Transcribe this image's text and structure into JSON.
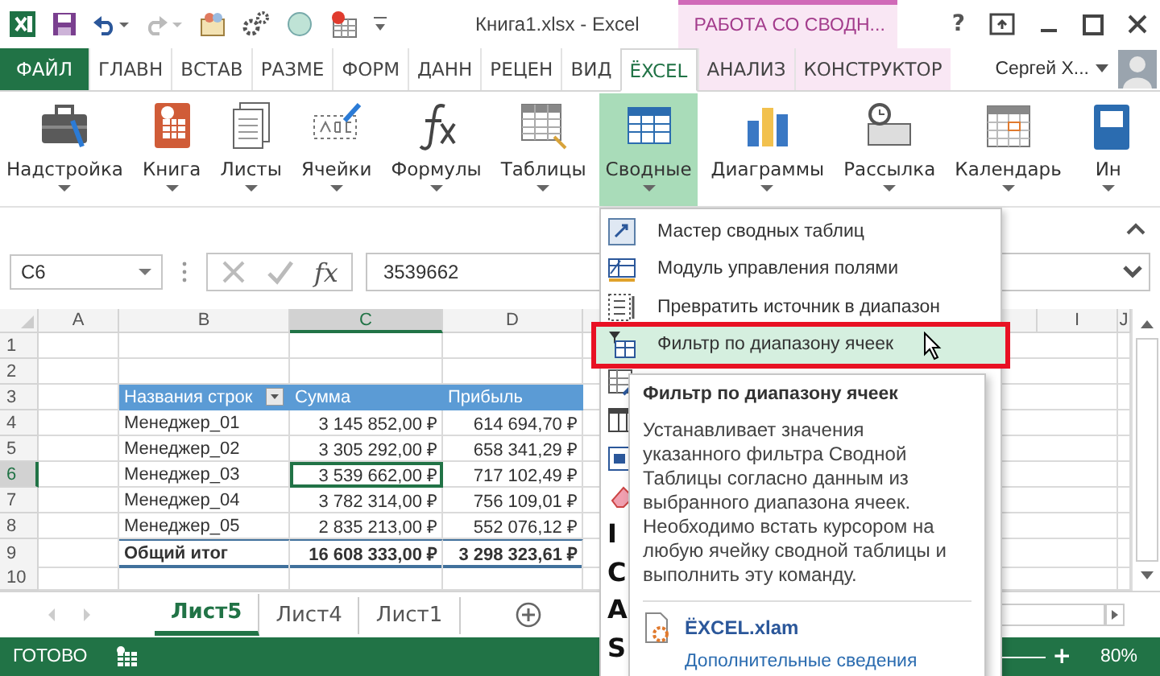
{
  "title_bar": {
    "title": "Книга1.xlsx - Excel",
    "context_tab": "РАБОТА СО СВОДН...",
    "help": "?"
  },
  "ribbon_tabs": [
    {
      "label": "ФАЙЛ",
      "kind": "file",
      "selected": false
    },
    {
      "label": "ГЛАВН",
      "kind": "tab",
      "selected": false
    },
    {
      "label": "ВСТАВ",
      "kind": "tab",
      "selected": false
    },
    {
      "label": "РАЗМЕ",
      "kind": "tab",
      "selected": false
    },
    {
      "label": "ФОРМ",
      "kind": "tab",
      "selected": false
    },
    {
      "label": "ДАНН",
      "kind": "tab",
      "selected": false
    },
    {
      "label": "РЕЦЕН",
      "kind": "tab",
      "selected": false
    },
    {
      "label": "ВИД",
      "kind": "tab",
      "selected": false
    },
    {
      "label": "ЁXCEL",
      "kind": "tab",
      "selected": true
    },
    {
      "label": "АНАЛИЗ",
      "kind": "context",
      "selected": false
    },
    {
      "label": "КОНСТРУКТОР",
      "kind": "context",
      "selected": false
    }
  ],
  "user": {
    "name": "Сергей Х..."
  },
  "ribbon_buttons": [
    {
      "label": "Надстройка",
      "kind": "toolbox",
      "selected": false
    },
    {
      "label": "Книга",
      "kind": "book",
      "selected": false
    },
    {
      "label": "Листы",
      "kind": "pages",
      "selected": false
    },
    {
      "label": "Ячейки",
      "kind": "textbox",
      "selected": false
    },
    {
      "label": "Формулы",
      "kind": "formula",
      "selected": false
    },
    {
      "label": "Таблицы",
      "kind": "table",
      "selected": false
    },
    {
      "label": "Сводные",
      "kind": "pivot",
      "selected": true
    },
    {
      "label": "Диаграммы",
      "kind": "chart",
      "selected": false
    },
    {
      "label": "Рассылка",
      "kind": "mail",
      "selected": false
    },
    {
      "label": "Календарь",
      "kind": "calendar",
      "selected": false
    },
    {
      "label": "Ин",
      "kind": "info",
      "selected": false
    }
  ],
  "formula_bar": {
    "name_box": "C6",
    "function_label": "fx",
    "value": "3539662"
  },
  "sheet": {
    "columns": [
      {
        "label": "A",
        "selected": false
      },
      {
        "label": "B",
        "selected": false
      },
      {
        "label": "C",
        "selected": true
      },
      {
        "label": "D",
        "selected": false
      },
      {
        "label": "I",
        "selected": false
      },
      {
        "label": "J",
        "selected": false
      }
    ],
    "rows": [
      {
        "number": "1",
        "selected": false,
        "kind": "empty"
      },
      {
        "number": "2",
        "selected": false,
        "kind": "empty"
      },
      {
        "number": "3",
        "selected": false,
        "kind": "header",
        "cells": [
          {
            "text": "Названия строк",
            "selected": false
          },
          {
            "text": "Сумма",
            "selected": false
          },
          {
            "text": "Прибыль",
            "selected": false
          }
        ]
      },
      {
        "number": "4",
        "selected": false,
        "kind": "data",
        "cells": [
          {
            "text": "Менеджер_01",
            "selected": false
          },
          {
            "text": "3 145 852,00 ₽",
            "selected": false
          },
          {
            "text": "614 694,70 ₽",
            "selected": false
          }
        ]
      },
      {
        "number": "5",
        "selected": false,
        "kind": "data",
        "cells": [
          {
            "text": "Менеджер_02",
            "selected": false
          },
          {
            "text": "3 305 292,00 ₽",
            "selected": false
          },
          {
            "text": "658 341,29 ₽",
            "selected": false
          }
        ]
      },
      {
        "number": "6",
        "selected": true,
        "kind": "data",
        "cells": [
          {
            "text": "Менеджер_03",
            "selected": false
          },
          {
            "text": "3 539 662,00 ₽",
            "selected": true
          },
          {
            "text": "717 102,49 ₽",
            "selected": false
          }
        ]
      },
      {
        "number": "7",
        "selected": false,
        "kind": "data",
        "cells": [
          {
            "text": "Менеджер_04",
            "selected": false
          },
          {
            "text": "3 782 314,00 ₽",
            "selected": false
          },
          {
            "text": "756 109,01 ₽",
            "selected": false
          }
        ]
      },
      {
        "number": "8",
        "selected": false,
        "kind": "data",
        "cells": [
          {
            "text": "Менеджер_05",
            "selected": false
          },
          {
            "text": "2 835 213,00 ₽",
            "selected": false
          },
          {
            "text": "552 076,12 ₽",
            "selected": false
          }
        ]
      },
      {
        "number": "9",
        "selected": false,
        "kind": "total",
        "cells": [
          {
            "text": "Общий итог",
            "selected": false
          },
          {
            "text": "16 608 333,00 ₽",
            "selected": false
          },
          {
            "text": "3 298 323,61 ₽",
            "selected": false
          }
        ]
      },
      {
        "number": "10",
        "selected": false,
        "kind": "empty"
      }
    ]
  },
  "sheet_tabs": [
    {
      "label": "Лист5",
      "selected": true
    },
    {
      "label": "Лист4",
      "selected": false
    },
    {
      "label": "Лист1",
      "selected": false
    }
  ],
  "status_bar": {
    "status": "ГОТОВО",
    "zoom_in": "+",
    "zoom": "80%"
  },
  "menu": {
    "items": [
      {
        "kind": "wizard",
        "label": "Мастер сводных таблиц",
        "highlighted": false
      },
      {
        "kind": "fields",
        "label": "Модуль управления полями",
        "highlighted": false
      },
      {
        "kind": "range",
        "label": "Превратить источник в диапазон",
        "highlighted": false
      },
      {
        "kind": "filter",
        "label": "Фильтр по диапазону ячеек",
        "highlighted": true
      },
      {
        "kind": "edit",
        "highlighted": false
      },
      {
        "kind": "grid",
        "highlighted": false
      },
      {
        "kind": "export",
        "highlighted": false
      },
      {
        "kind": "eraser",
        "highlighted": false
      },
      {
        "kind": "letter",
        "label": "I",
        "highlighted": false
      },
      {
        "kind": "letter",
        "label": "C",
        "highlighted": false
      },
      {
        "kind": "letter",
        "label": "A",
        "highlighted": false
      },
      {
        "kind": "letter",
        "label": "S",
        "highlighted": false
      }
    ]
  },
  "tooltip": {
    "title": "Фильтр по диапазону ячеек",
    "body": "Устанавливает значения указанного фильтра Сводной Таблицы согласно данным из выбранного диапазона ячеек. Необходимо встать курсором на любую ячейку сводной таблицы и выполнить эту команду.",
    "addin": "ЁXCEL.xlam",
    "link": "Дополнительные сведения"
  }
}
